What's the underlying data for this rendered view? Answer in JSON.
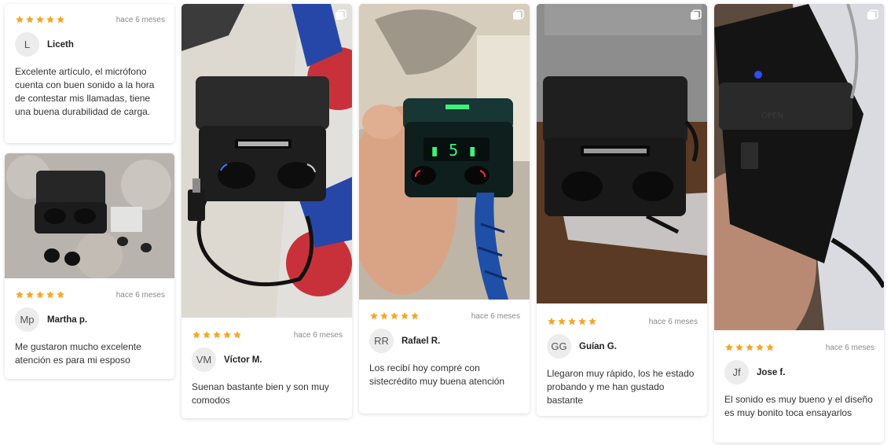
{
  "colors": {
    "star": "#f6a623",
    "date": "#8a8a8a",
    "avatar_bg": "#ececec"
  },
  "icons": {
    "rating": "star-icon",
    "gallery": "multiple-photos-icon"
  },
  "reviews": [
    {
      "rating": 5,
      "date": "hace 6 meses",
      "initials": "L",
      "author": "Liceth",
      "text": "Excelente artículo, el micrófono cuenta con buen sonido a la hora de contestar mis llamadas, tiene una buena durabilidad de carga."
    },
    {
      "rating": 5,
      "date": "hace 6 meses",
      "initials": "Mp",
      "author": "Martha p.",
      "text": "Me gustaron mucho excelente atención es para mi esposo"
    },
    {
      "rating": 5,
      "date": "hace 6 meses",
      "initials": "VM",
      "author": "Víctor M.",
      "text": "Suenan bastante bien y son muy comodos"
    },
    {
      "rating": 5,
      "date": "hace 6 meses",
      "initials": "RR",
      "author": "Rafael R.",
      "text": "Los recibí hoy compré con sistecrédito muy buena atención"
    },
    {
      "rating": 5,
      "date": "hace 6 meses",
      "initials": "GG",
      "author": "Guían G.",
      "text": "Llegaron muy rápido, los he estado probando y me han gustado bastante"
    },
    {
      "rating": 5,
      "date": "hace 6 meses",
      "initials": "Jf",
      "author": "Jose f.",
      "text": "El sonido es muy bueno y el diseño es muy bonito toca ensayarlos"
    }
  ]
}
